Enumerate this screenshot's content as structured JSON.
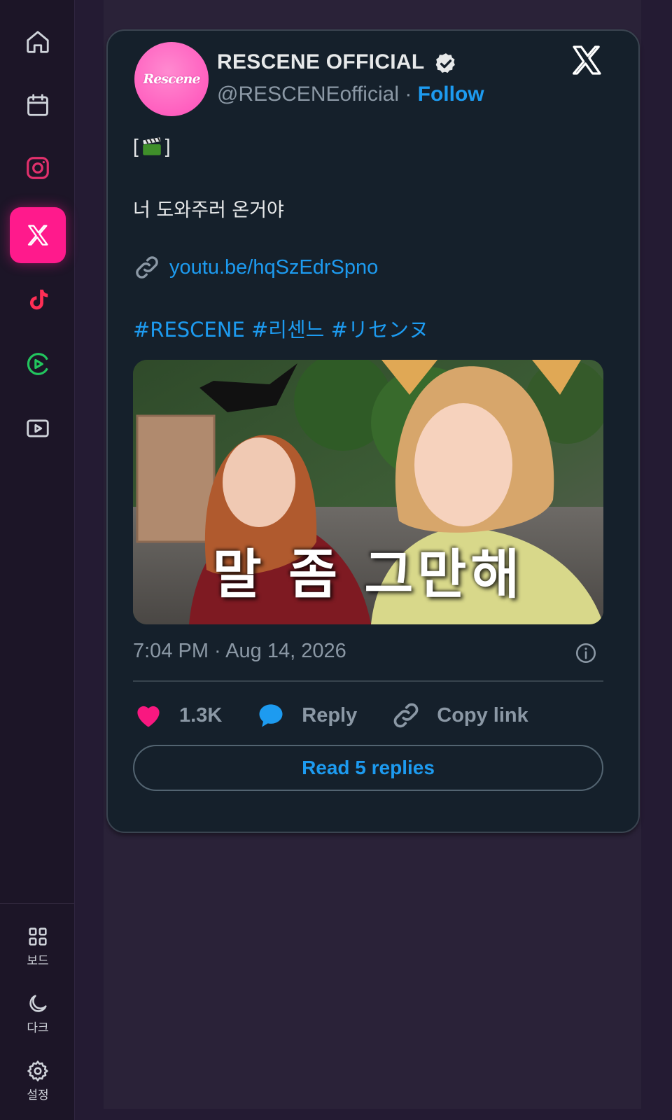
{
  "sidebar": {
    "nav": [
      {
        "name": "home-icon",
        "color": "#cfd3da"
      },
      {
        "name": "calendar-icon",
        "color": "#cfd3da"
      },
      {
        "name": "instagram-icon",
        "color": "#e1306c"
      },
      {
        "name": "x-icon",
        "color": "#ffffff",
        "active": true
      },
      {
        "name": "tiktok-icon",
        "color": "#ff2e55"
      },
      {
        "name": "play-circle-icon",
        "color": "#22c55e"
      },
      {
        "name": "video-icon",
        "color": "#cfd3da"
      }
    ],
    "bottom": {
      "board_label": "보드",
      "dark_label": "다크",
      "settings_label": "설정"
    }
  },
  "tweet": {
    "avatar_text": "Rescene",
    "display_name": "RESCENE OFFICIAL",
    "handle": "@RESCENEofficial",
    "separator": " · ",
    "follow_label": "Follow",
    "bracket_open": "[",
    "bracket_close": "]",
    "text_line": "너 도와주러 온거야",
    "link": "youtu.be/hqSzEdrSpno",
    "hashtags": [
      "#RESCENE",
      "#리센느",
      "#リセンヌ"
    ],
    "media_caption": "말 좀 그만해",
    "timestamp": "7:04 PM · Aug 14, 2026",
    "like_count": "1.3K",
    "reply_label": "Reply",
    "copy_label": "Copy link",
    "read_replies_label": "Read 5 replies"
  },
  "colors": {
    "accent_pink": "#ff1a8c",
    "link_blue": "#1d9bf0",
    "card_bg": "#15202b",
    "like_red": "#f91880"
  }
}
